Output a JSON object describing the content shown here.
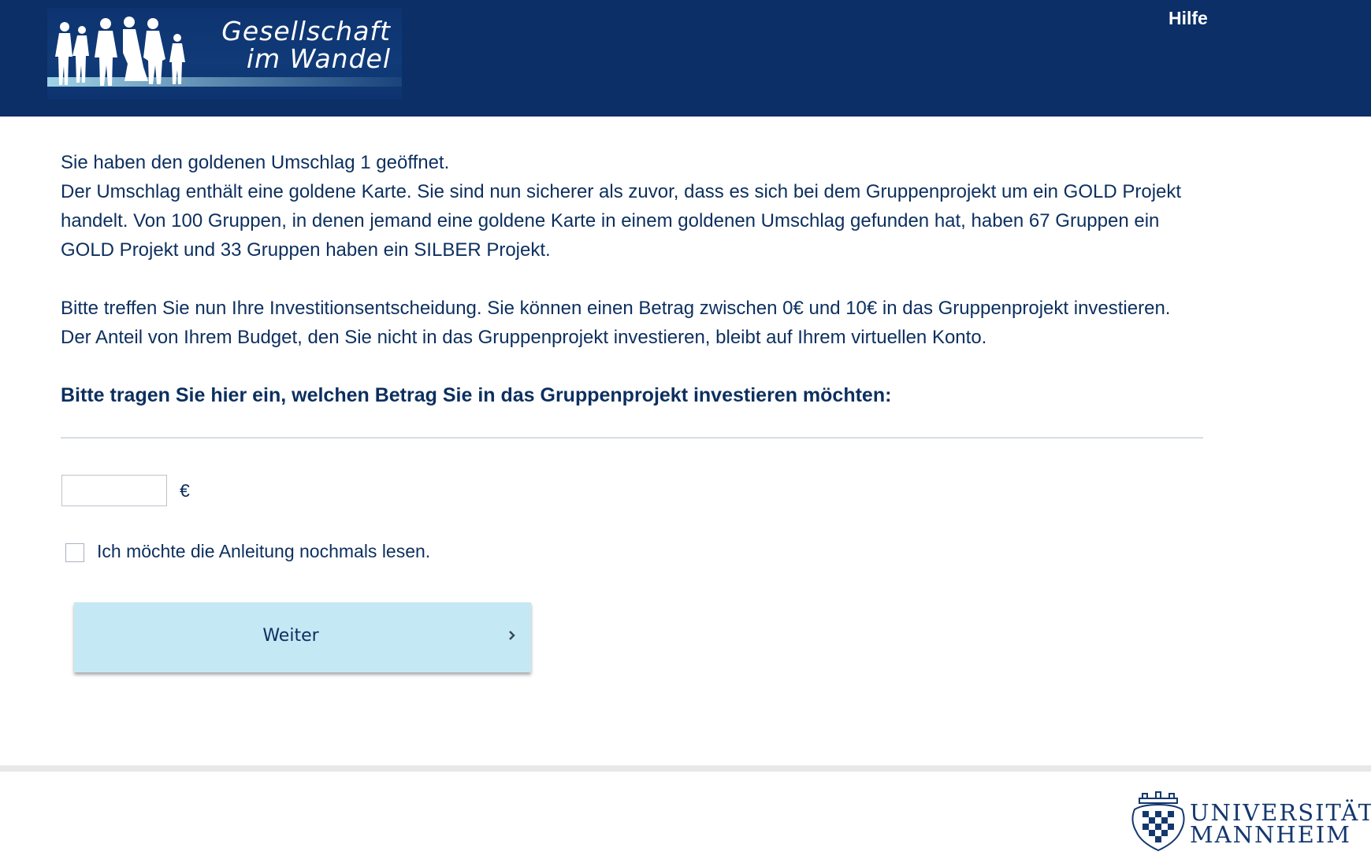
{
  "header": {
    "logo_line1": "Gesellschaft",
    "logo_line2": "im Wandel",
    "help_label": "Hilfe"
  },
  "main": {
    "para1_line1": "Sie haben den goldenen Umschlag 1 geöffnet.",
    "para1_rest": "Der Umschlag enthält eine goldene Karte. Sie sind nun sicherer als zuvor, dass es sich bei dem Gruppenprojekt um ein GOLD Projekt handelt. Von 100 Gruppen, in denen jemand eine goldene Karte in einem goldenen Umschlag gefunden hat, haben 67 Gruppen ein GOLD Projekt und 33 Gruppen haben ein SILBER Projekt.",
    "para2": "Bitte treffen Sie nun Ihre Investitionsentscheidung. Sie können einen Betrag zwischen 0€ und 10€ in das Gruppenprojekt investieren. Der Anteil von Ihrem Budget, den Sie nicht in das Gruppenprojekt investieren, bleibt auf Ihrem virtuellen Konto.",
    "prompt": "Bitte tragen Sie hier ein, welchen Betrag Sie in das Gruppenprojekt investieren möchten:"
  },
  "form": {
    "amount_value": "",
    "currency_symbol": "€",
    "reread_checkbox_label": "Ich möchte die Anleitung nochmals lesen.",
    "reread_checked": false,
    "next_button_label": "Weiter"
  },
  "footer": {
    "university_line1": "UNIVERSITÄT",
    "university_line2": "MANNHEIM"
  },
  "colors": {
    "header_bg": "#0b2f66",
    "text": "#0c2f5f",
    "button_bg": "#c5e8f5"
  },
  "icons": {
    "logo_figures": "family-silhouette-icon",
    "next": "chevron-right-icon",
    "university_crest": "university-crest-icon"
  }
}
